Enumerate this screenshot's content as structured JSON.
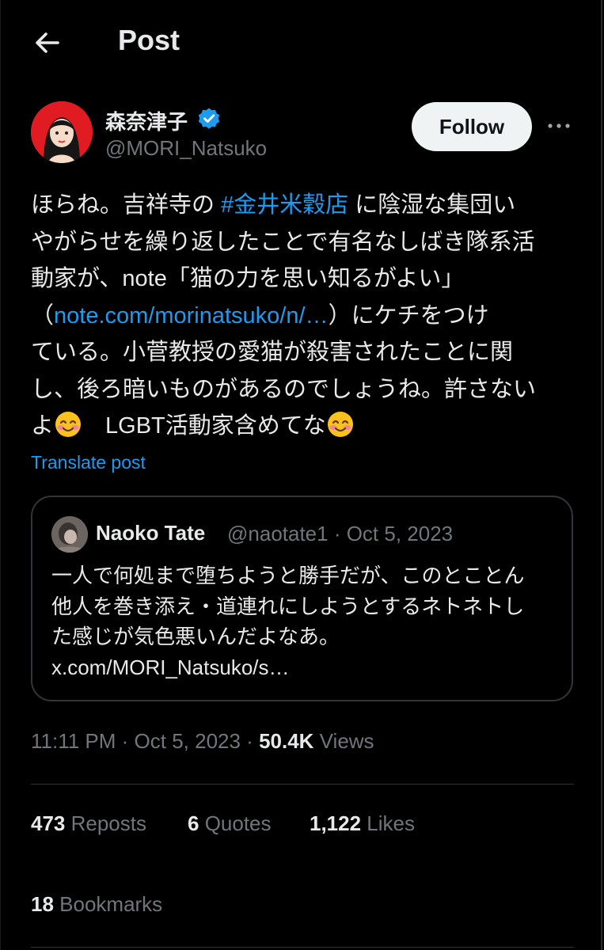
{
  "header": {
    "title": "Post"
  },
  "author": {
    "name": "森奈津子",
    "handle": "@MORI_Natsuko",
    "follow_label": "Follow"
  },
  "post": {
    "lines": [
      [
        "ほらね。吉祥寺の ",
        "#金井米穀店",
        " に陰湿な集団い"
      ],
      [
        "やがらせを繰り返したことで有名なしばき隊系活"
      ],
      [
        "動家が、note「猫の力を思い知るがよい」"
      ],
      [
        "（",
        "note.com/morinatsuko/n/…",
        "）にケチをつけ"
      ],
      [
        "ている。小菅教授の愛猫が殺害されたことに関"
      ],
      [
        "し、後ろ暗いものがあるのでしょうね。許さない"
      ],
      [
        "よ",
        "　LGBT活動家含めてな"
      ]
    ],
    "translate_label": "Translate post"
  },
  "quote": {
    "name": "Naoko Tate",
    "handle_date": "@naotate1 · Oct 5, 2023",
    "lines": [
      "一人で何処まで堕ちようと勝手だが、このとことん",
      "他人を巻き添え・道連れにしようとするネトネトし",
      "た感じが気色悪いんだよなあ。",
      "x.com/MORI_Natsuko/s…"
    ]
  },
  "meta": {
    "time_date": "11:11 PM · Oct 5, 2023 · ",
    "views_count": "50.4K",
    "views_label": " Views"
  },
  "stats": {
    "reposts_count": "473",
    "reposts_label": " Reposts",
    "quotes_count": "6",
    "quotes_label": " Quotes",
    "likes_count": "1,122",
    "likes_label": " Likes",
    "bookmarks_count": "18",
    "bookmarks_label": " Bookmarks"
  },
  "colors": {
    "accent": "#1d9bf0",
    "muted": "#71767b",
    "text": "#e7e9ea",
    "background": "#000000"
  }
}
